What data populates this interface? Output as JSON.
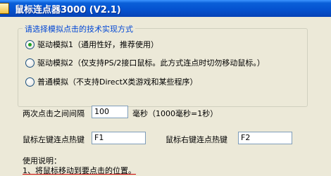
{
  "window": {
    "title": "鼠标连点器3000 (V2.1)"
  },
  "mode_group": {
    "caption": "请选择模拟点击的技术实现方式",
    "options": [
      {
        "label": "驱动模拟1（通用性好，推荐使用）",
        "checked": true
      },
      {
        "label": "驱动模拟2（仅支持PS/2接口鼠标。此方式连点时切勿移动鼠标。）",
        "checked": false
      },
      {
        "label": "普通模拟（不支持DirectX类游戏和某些程序）",
        "checked": false
      }
    ]
  },
  "interval": {
    "label": "两次点击之间间隔",
    "value": "100",
    "unit_hint": "毫秒（1000毫秒=1秒）"
  },
  "hotkeys": {
    "left_label": "鼠标左键连点热键",
    "left_value": "F1",
    "right_label": "鼠标右键连点热键",
    "right_value": "F2"
  },
  "usage": {
    "title": "使用说明：",
    "step1": "1、将鼠标移动到要点击的位置。"
  }
}
